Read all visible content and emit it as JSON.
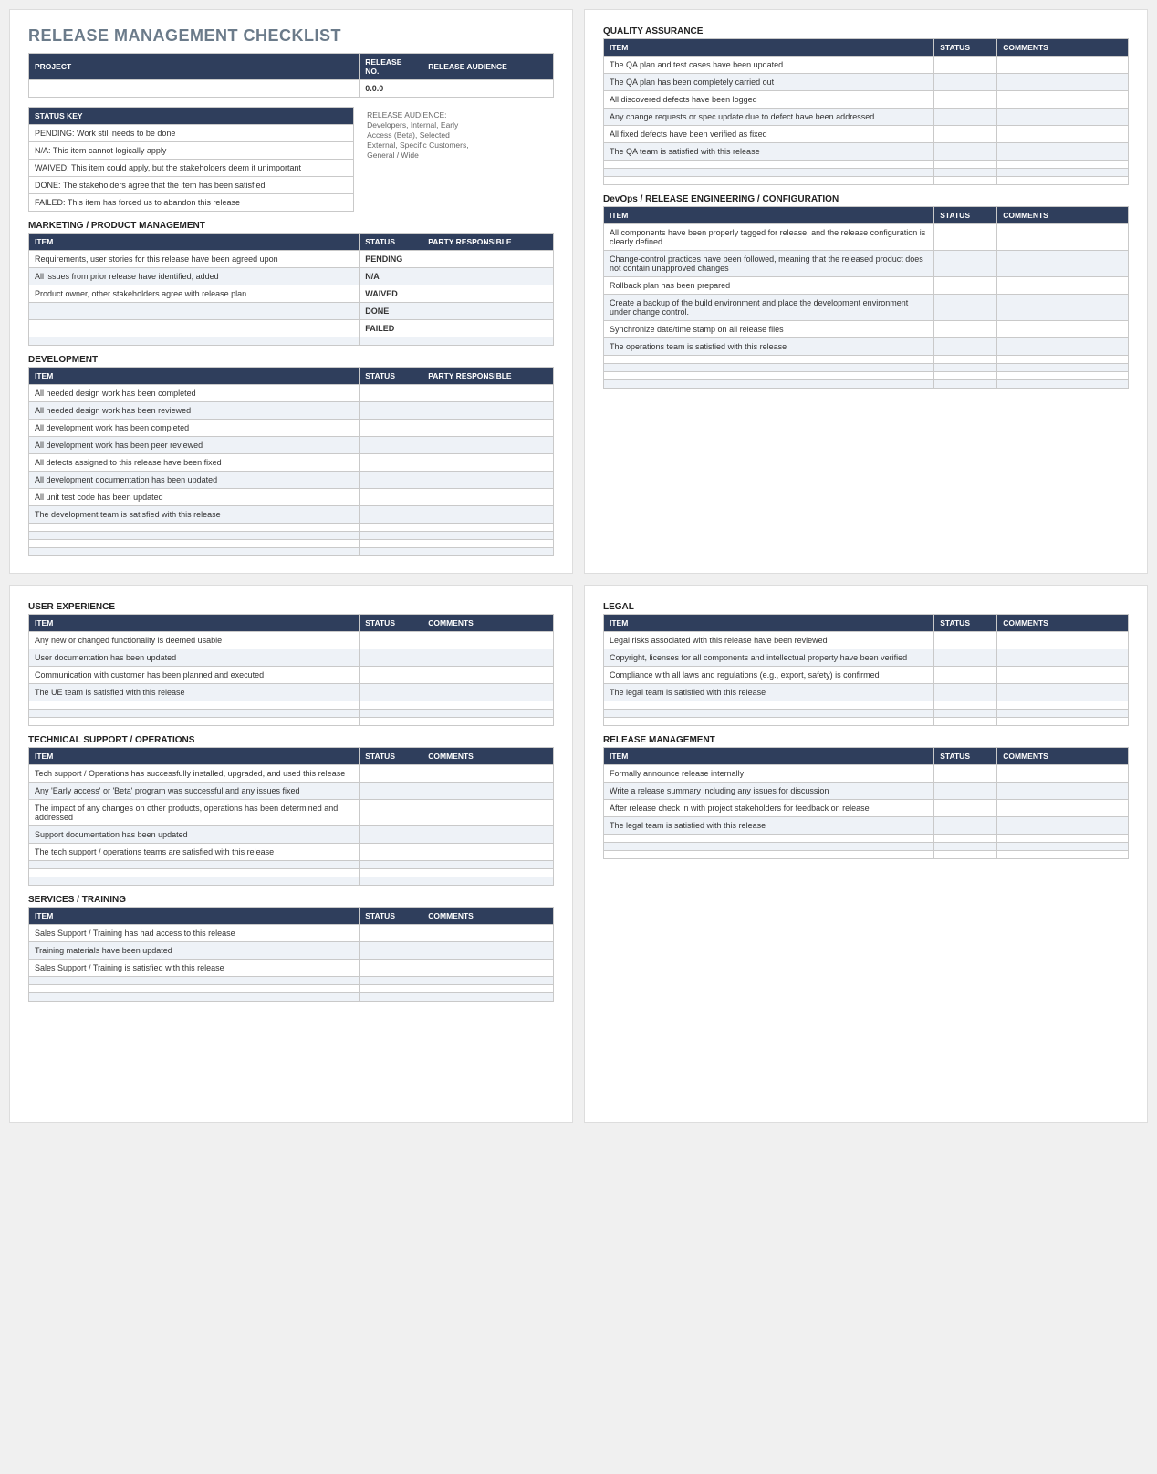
{
  "title": "RELEASE MANAGEMENT CHECKLIST",
  "projectTable": {
    "h1": "PROJECT",
    "h2": "RELEASE NO.",
    "h3": "RELEASE AUDIENCE",
    "release_no": "0.0.0"
  },
  "statusKey": {
    "header": "STATUS KEY",
    "rows": [
      "PENDING:  Work still needs to be done",
      "N/A:  This item cannot logically apply",
      "WAIVED:  This item could apply, but the stakeholders deem it unimportant",
      "DONE:  The stakeholders agree that the item has been satisfied",
      "FAILED:  This item has forced us to abandon this release"
    ]
  },
  "audienceNote": {
    "l1": "RELEASE AUDIENCE:",
    "l2": "Developers, Internal, Early Access (Beta), Selected External, Specific Customers, General / Wide"
  },
  "headers": {
    "item": "ITEM",
    "status": "STATUS",
    "party": "PARTY RESPONSIBLE",
    "comments": "COMMENTS"
  },
  "sections": {
    "marketing": {
      "title": "MARKETING / PRODUCT MANAGEMENT",
      "thirdCol": "party",
      "rows": [
        {
          "item": "Requirements, user stories for this release have been agreed upon",
          "status": "PENDING"
        },
        {
          "item": "All issues from prior release have identified, added",
          "status": "N/A"
        },
        {
          "item": "Product owner, other stakeholders agree with release plan",
          "status": "WAIVED"
        },
        {
          "item": "",
          "status": "DONE"
        },
        {
          "item": "",
          "status": "FAILED"
        },
        {
          "item": "",
          "status": ""
        }
      ]
    },
    "development": {
      "title": "DEVELOPMENT",
      "thirdCol": "party",
      "rows": [
        {
          "item": "All needed design work has been completed"
        },
        {
          "item": "All needed design work has been reviewed"
        },
        {
          "item": "All development work has been completed"
        },
        {
          "item": "All development work has been peer reviewed"
        },
        {
          "item": "All defects assigned to this release have been fixed"
        },
        {
          "item": "All development documentation has been updated"
        },
        {
          "item": "All unit test code has been updated"
        },
        {
          "item": "The development team is satisfied with this release"
        },
        {
          "item": ""
        },
        {
          "item": ""
        },
        {
          "item": ""
        },
        {
          "item": ""
        }
      ]
    },
    "qa": {
      "title": "QUALITY ASSURANCE",
      "thirdCol": "comments",
      "rows": [
        {
          "item": "The QA plan and test cases have been updated"
        },
        {
          "item": "The QA plan has been completely carried out"
        },
        {
          "item": "All discovered defects have been logged"
        },
        {
          "item": "Any change requests or spec update due to defect have been addressed"
        },
        {
          "item": "All fixed defects have been verified as fixed"
        },
        {
          "item": "The QA team is satisfied with this release"
        },
        {
          "item": ""
        },
        {
          "item": ""
        },
        {
          "item": ""
        }
      ]
    },
    "devops": {
      "title": "DevOps / RELEASE ENGINEERING / CONFIGURATION",
      "thirdCol": "comments",
      "rows": [
        {
          "item": "All components have been properly tagged for release, and the release configuration is clearly defined"
        },
        {
          "item": "Change-control practices have been followed, meaning that the released product does not contain unapproved changes"
        },
        {
          "item": "Rollback plan has been prepared"
        },
        {
          "item": "Create a backup of the build environment and place the development environment under change control."
        },
        {
          "item": "Synchronize date/time stamp on all release files"
        },
        {
          "item": "The operations team is satisfied with this release"
        },
        {
          "item": ""
        },
        {
          "item": ""
        },
        {
          "item": ""
        },
        {
          "item": ""
        }
      ]
    },
    "ux": {
      "title": "USER EXPERIENCE",
      "thirdCol": "comments",
      "rows": [
        {
          "item": "Any new or changed functionality is deemed usable"
        },
        {
          "item": "User documentation has been updated"
        },
        {
          "item": "Communication with customer has been planned and executed"
        },
        {
          "item": "The UE team is satisfied with this release"
        },
        {
          "item": ""
        },
        {
          "item": ""
        },
        {
          "item": ""
        }
      ]
    },
    "techsupport": {
      "title": "TECHNICAL SUPPORT / OPERATIONS",
      "thirdCol": "comments",
      "rows": [
        {
          "item": "Tech support / Operations has successfully installed, upgraded, and used this release"
        },
        {
          "item": "Any 'Early access' or 'Beta' program was successful and any issues fixed"
        },
        {
          "item": "The impact of any changes on other products, operations has been determined and addressed"
        },
        {
          "item": "Support documentation has been updated"
        },
        {
          "item": "The tech support / operations teams are satisfied with this release"
        },
        {
          "item": ""
        },
        {
          "item": ""
        },
        {
          "item": ""
        }
      ]
    },
    "services": {
      "title": "SERVICES / TRAINING",
      "thirdCol": "comments",
      "rows": [
        {
          "item": "Sales Support / Training has had access to this release"
        },
        {
          "item": "Training materials have been updated"
        },
        {
          "item": "Sales Support / Training is satisfied with this release"
        },
        {
          "item": ""
        },
        {
          "item": ""
        },
        {
          "item": ""
        }
      ]
    },
    "legal": {
      "title": "LEGAL",
      "thirdCol": "comments",
      "rows": [
        {
          "item": "Legal risks associated with this release have been reviewed"
        },
        {
          "item": "Copyright, licenses for all components and intellectual property have been verified"
        },
        {
          "item": "Compliance with all laws and regulations (e.g., export, safety) is confirmed"
        },
        {
          "item": "The legal team is satisfied with this release"
        },
        {
          "item": ""
        },
        {
          "item": ""
        },
        {
          "item": ""
        }
      ]
    },
    "releasemgmt": {
      "title": "RELEASE MANAGEMENT",
      "thirdCol": "comments",
      "rows": [
        {
          "item": "Formally announce release internally"
        },
        {
          "item": "Write a release summary including any issues for discussion"
        },
        {
          "item": "After release check in with project stakeholders for feedback on release"
        },
        {
          "item": "The legal team is satisfied with this release"
        },
        {
          "item": ""
        },
        {
          "item": ""
        },
        {
          "item": ""
        }
      ]
    }
  }
}
